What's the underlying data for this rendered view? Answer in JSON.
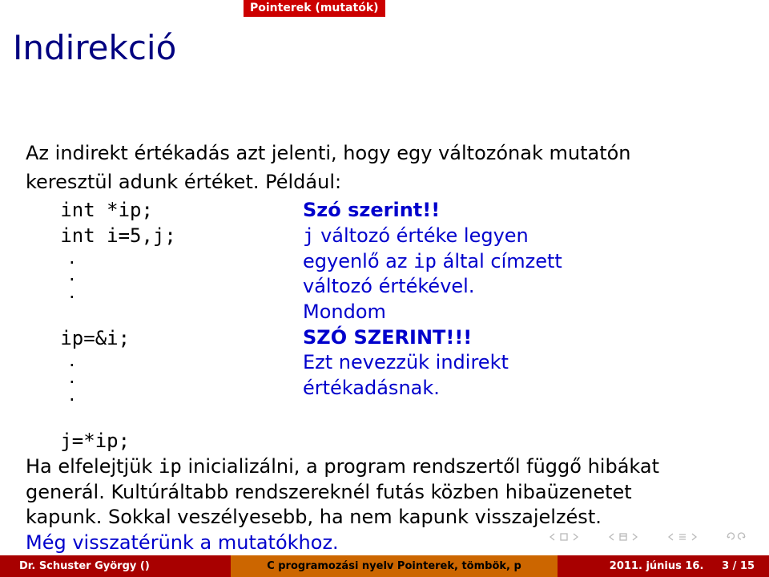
{
  "outline": "Pointerek (mutatók)",
  "title": "Indirekció",
  "intro1": "Az indirekt értékadás azt jelenti, hogy egy változónak mutatón",
  "intro2": "keresztül adunk értéket. Például:",
  "code": {
    "l1": "   int *ip;",
    "l2": "   int i=5,j;",
    "l3": "   ip=&i;",
    "l4": "   j=*ip;"
  },
  "comment": {
    "szo_szerint": "Szó szerint!!",
    "c1a": "j",
    "c1b": " változó értéke legyen",
    "c2a": "egyenlő az ",
    "c2b": "ip",
    "c2c": " által címzett",
    "c3": "változó értékével.",
    "c4": "Mondom",
    "c5": "SZÓ SZERINT!!!",
    "c6": "Ezt nevezzük indirekt",
    "c7": "értékadásnak."
  },
  "after": {
    "a1a": "Ha elfelejtjük ",
    "a1b": "ip",
    "a1c": " inicializálni, a program rendszertől függő hibákat",
    "a2": "generál. Kultúráltabb rendszereknél futás közben hibaüzenetet",
    "a3": "kapunk. Sokkal veszélyesebb, ha nem kapunk visszajelzést.",
    "a4": "Még visszatérünk a mutatókhoz."
  },
  "footer": {
    "author": "Dr. Schuster György ()",
    "doctitle": "C programozási nyelv Pointerek, tömbök, p",
    "date": "2011. június 16.",
    "page": "3 / 15"
  }
}
